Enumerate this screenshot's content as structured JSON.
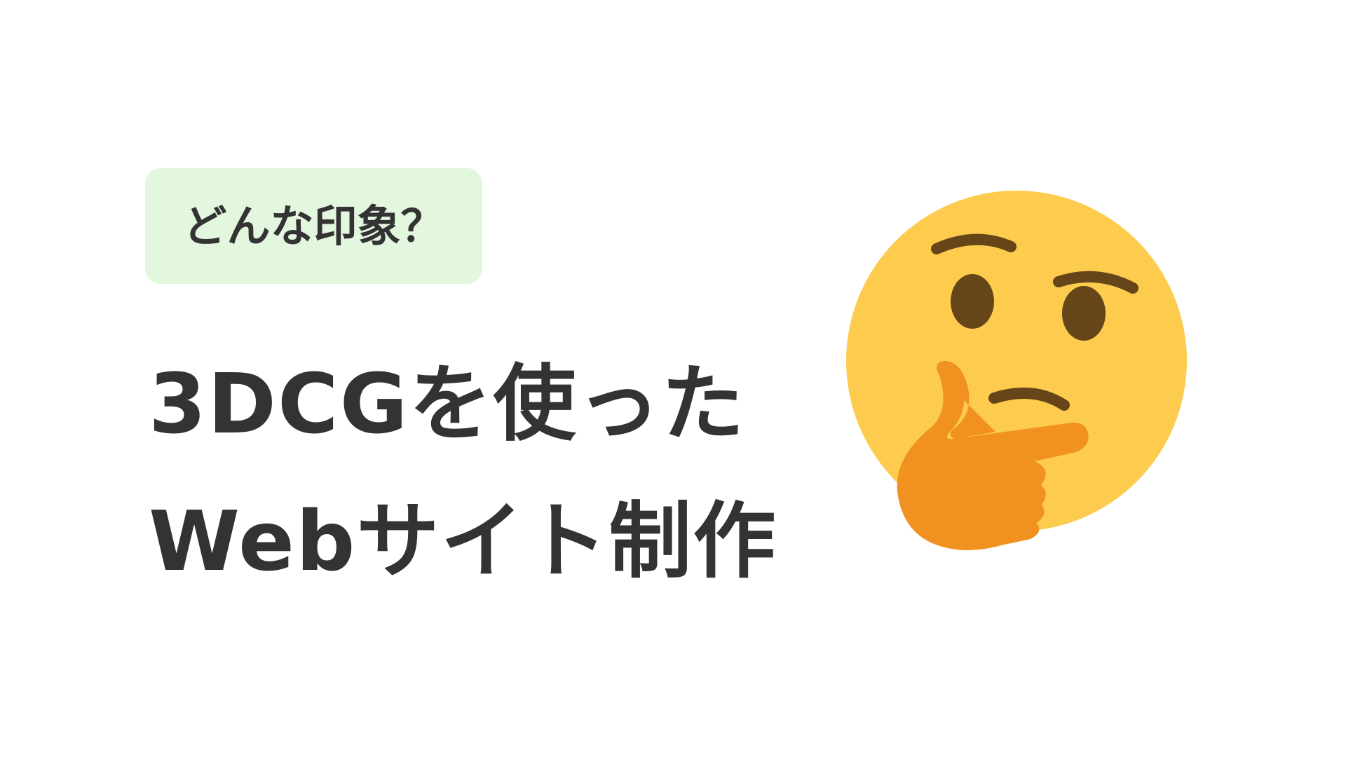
{
  "badge": {
    "label": "どんな印象？"
  },
  "headline": {
    "line1": "3DCGを使った",
    "line2": "Webサイト制作"
  },
  "illustration": {
    "icon": "thinking-face-icon"
  },
  "colors": {
    "background": "#ffffff",
    "badge_background": "#e3f6de",
    "text": "#333333",
    "face": "#fdcb4e",
    "feature": "#664518",
    "hand": "#f09120"
  }
}
